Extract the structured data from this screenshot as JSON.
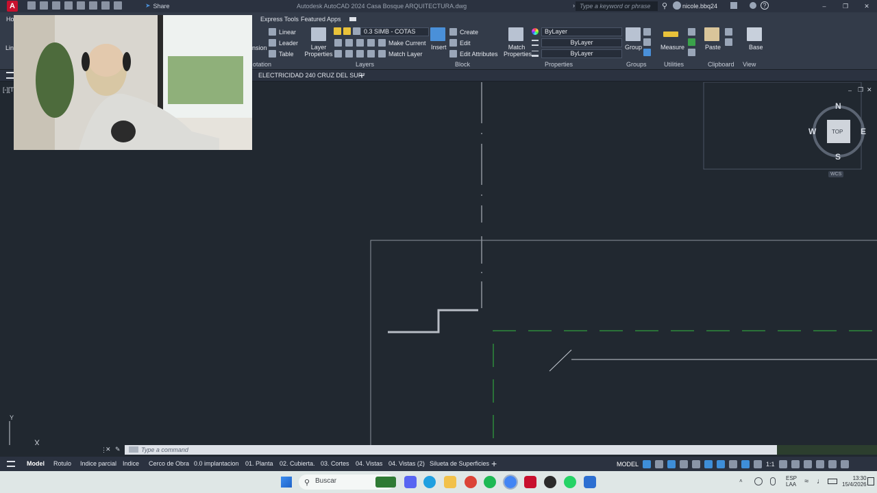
{
  "titlebar": {
    "app_letter": "A",
    "share_label": "Share",
    "doc_title": "Autodesk AutoCAD 2024   Casa Bosque ARQUITECTURA.dwg",
    "search_placeholder": "Type a keyword or phrase",
    "user": "nicole.bbq24"
  },
  "ribbon": {
    "tabs": [
      "Ho",
      "Express Tools",
      "Featured Apps"
    ],
    "annotation": {
      "partial_left": "Lin",
      "partial_dim": "nsion",
      "linear": "Linear",
      "leader": "Leader",
      "table": "Table",
      "title": "otation"
    },
    "layers": {
      "layer_properties": "Layer Properties",
      "current_layer": "0.3 SIMB - COTAS",
      "make_current": "Make Current",
      "match_layer": "Match Layer",
      "title": "Layers"
    },
    "block": {
      "insert": "Insert",
      "create": "Create",
      "edit": "Edit",
      "edit_attributes": "Edit Attributes",
      "title": "Block"
    },
    "properties": {
      "match_properties": "Match Properties",
      "color": "ByLayer",
      "linetype": "ByLayer",
      "lineweight": "ByLayer",
      "title": "Properties"
    },
    "groups": {
      "group": "Group",
      "title": "Groups"
    },
    "utilities": {
      "measure": "Measure",
      "title": "Utilities"
    },
    "clipboard": {
      "paste": "Paste",
      "title": "Clipboard"
    },
    "view": {
      "base": "Base",
      "title": "View"
    }
  },
  "filetab": {
    "name": "ELECTRICIDAD 240 CRUZ DEL SUR*",
    "left_stub": "[-][T"
  },
  "viewcube": {
    "n": "N",
    "s": "S",
    "e": "E",
    "w": "W",
    "face": "TOP",
    "wcs": "WCS"
  },
  "ucs": {
    "y": "Y",
    "x": "X"
  },
  "command": {
    "placeholder": "Type a command"
  },
  "layout_tabs": [
    "Model",
    "Rotulo",
    "Indice parcial",
    "Indice",
    "Cerco de Obra",
    "0.0 implantacion",
    "01. Planta",
    "02. Cubierta.",
    "03. Cortes",
    "04. Vistas",
    "04. Vistas (2)",
    "Silueta de Superficies"
  ],
  "status": {
    "model": "MODEL",
    "scale": "1:1"
  },
  "taskbar": {
    "search": "Buscar",
    "lang_top": "ESP",
    "lang_bottom": "LAA",
    "time": "13:30",
    "date": "15/4/2026"
  },
  "colors": {
    "canvas": "#212830",
    "ribbon": "#333b49",
    "accent_green": "#2e8b3a",
    "autocad_red": "#c8102e"
  }
}
